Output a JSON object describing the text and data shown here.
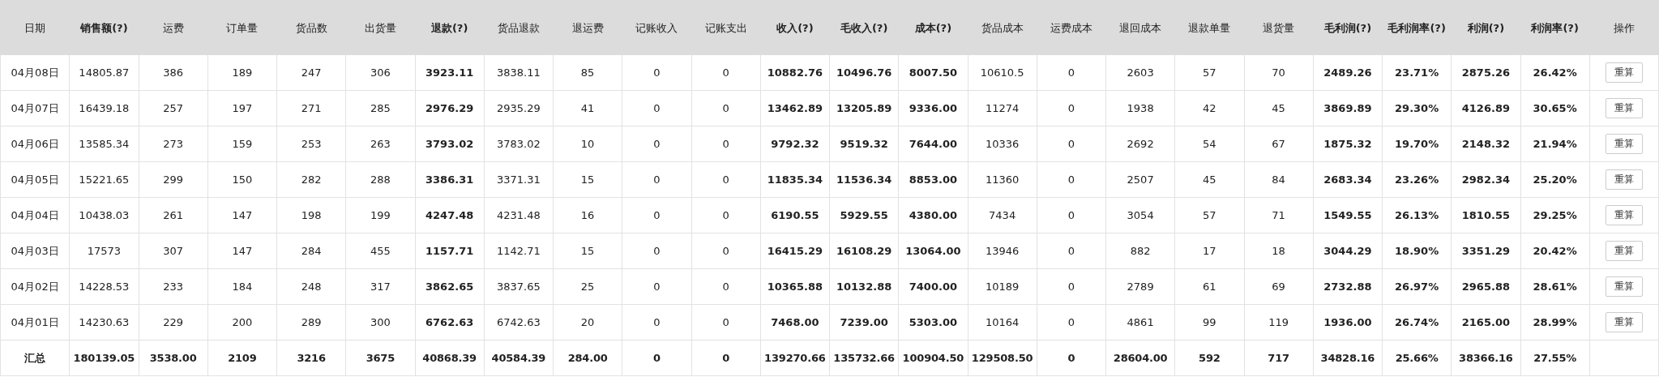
{
  "table": {
    "columns": [
      {
        "label": "日期",
        "emphasis": false,
        "values_emphasis": false
      },
      {
        "label": "销售额(?)",
        "emphasis": true,
        "values_emphasis": false
      },
      {
        "label": "运费",
        "emphasis": false,
        "values_emphasis": false
      },
      {
        "label": "订单量",
        "emphasis": false,
        "values_emphasis": false
      },
      {
        "label": "货品数",
        "emphasis": false,
        "values_emphasis": false
      },
      {
        "label": "出货量",
        "emphasis": false,
        "values_emphasis": false
      },
      {
        "label": "退款(?)",
        "emphasis": true,
        "values_emphasis": true
      },
      {
        "label": "货品退款",
        "emphasis": false,
        "values_emphasis": false
      },
      {
        "label": "退运费",
        "emphasis": false,
        "values_emphasis": false
      },
      {
        "label": "记账收入",
        "emphasis": false,
        "values_emphasis": false
      },
      {
        "label": "记账支出",
        "emphasis": false,
        "values_emphasis": false
      },
      {
        "label": "收入(?)",
        "emphasis": true,
        "values_emphasis": true
      },
      {
        "label": "毛收入(?)",
        "emphasis": true,
        "values_emphasis": true
      },
      {
        "label": "成本(?)",
        "emphasis": true,
        "values_emphasis": true
      },
      {
        "label": "货品成本",
        "emphasis": false,
        "values_emphasis": false
      },
      {
        "label": "运费成本",
        "emphasis": false,
        "values_emphasis": false
      },
      {
        "label": "退回成本",
        "emphasis": false,
        "values_emphasis": false
      },
      {
        "label": "退款单量",
        "emphasis": false,
        "values_emphasis": false
      },
      {
        "label": "退货量",
        "emphasis": false,
        "values_emphasis": false
      },
      {
        "label": "毛利润(?)",
        "emphasis": true,
        "values_emphasis": true
      },
      {
        "label": "毛利润率(?)",
        "emphasis": true,
        "values_emphasis": true
      },
      {
        "label": "利润(?)",
        "emphasis": true,
        "values_emphasis": true
      },
      {
        "label": "利润率(?)",
        "emphasis": true,
        "values_emphasis": true
      },
      {
        "label": "操作",
        "emphasis": false
      }
    ],
    "rows": [
      {
        "cells": [
          "04月08日",
          "14805.87",
          "386",
          "189",
          "247",
          "306",
          "3923.11",
          "3838.11",
          "85",
          "0",
          "0",
          "10882.76",
          "10496.76",
          "8007.50",
          "10610.5",
          "0",
          "2603",
          "57",
          "70",
          "2489.26",
          "23.71%",
          "2875.26",
          "26.42%"
        ],
        "action": "重算"
      },
      {
        "cells": [
          "04月07日",
          "16439.18",
          "257",
          "197",
          "271",
          "285",
          "2976.29",
          "2935.29",
          "41",
          "0",
          "0",
          "13462.89",
          "13205.89",
          "9336.00",
          "11274",
          "0",
          "1938",
          "42",
          "45",
          "3869.89",
          "29.30%",
          "4126.89",
          "30.65%"
        ],
        "action": "重算"
      },
      {
        "cells": [
          "04月06日",
          "13585.34",
          "273",
          "159",
          "253",
          "263",
          "3793.02",
          "3783.02",
          "10",
          "0",
          "0",
          "9792.32",
          "9519.32",
          "7644.00",
          "10336",
          "0",
          "2692",
          "54",
          "67",
          "1875.32",
          "19.70%",
          "2148.32",
          "21.94%"
        ],
        "action": "重算"
      },
      {
        "cells": [
          "04月05日",
          "15221.65",
          "299",
          "150",
          "282",
          "288",
          "3386.31",
          "3371.31",
          "15",
          "0",
          "0",
          "11835.34",
          "11536.34",
          "8853.00",
          "11360",
          "0",
          "2507",
          "45",
          "84",
          "2683.34",
          "23.26%",
          "2982.34",
          "25.20%"
        ],
        "action": "重算"
      },
      {
        "cells": [
          "04月04日",
          "10438.03",
          "261",
          "147",
          "198",
          "199",
          "4247.48",
          "4231.48",
          "16",
          "0",
          "0",
          "6190.55",
          "5929.55",
          "4380.00",
          "7434",
          "0",
          "3054",
          "57",
          "71",
          "1549.55",
          "26.13%",
          "1810.55",
          "29.25%"
        ],
        "action": "重算"
      },
      {
        "cells": [
          "04月03日",
          "17573",
          "307",
          "147",
          "284",
          "455",
          "1157.71",
          "1142.71",
          "15",
          "0",
          "0",
          "16415.29",
          "16108.29",
          "13064.00",
          "13946",
          "0",
          "882",
          "17",
          "18",
          "3044.29",
          "18.90%",
          "3351.29",
          "20.42%"
        ],
        "action": "重算"
      },
      {
        "cells": [
          "04月02日",
          "14228.53",
          "233",
          "184",
          "248",
          "317",
          "3862.65",
          "3837.65",
          "25",
          "0",
          "0",
          "10365.88",
          "10132.88",
          "7400.00",
          "10189",
          "0",
          "2789",
          "61",
          "69",
          "2732.88",
          "26.97%",
          "2965.88",
          "28.61%"
        ],
        "action": "重算"
      },
      {
        "cells": [
          "04月01日",
          "14230.63",
          "229",
          "200",
          "289",
          "300",
          "6762.63",
          "6742.63",
          "20",
          "0",
          "0",
          "7468.00",
          "7239.00",
          "5303.00",
          "10164",
          "0",
          "4861",
          "99",
          "119",
          "1936.00",
          "26.74%",
          "2165.00",
          "28.99%"
        ],
        "action": "重算"
      }
    ],
    "total": {
      "cells": [
        "汇总",
        "180139.05",
        "3538.00",
        "2109",
        "3216",
        "3675",
        "40868.39",
        "40584.39",
        "284.00",
        "0",
        "0",
        "139270.66",
        "135732.66",
        "100904.50",
        "129508.50",
        "0",
        "28604.00",
        "592",
        "717",
        "34828.16",
        "25.66%",
        "38366.16",
        "27.55%"
      ]
    }
  }
}
